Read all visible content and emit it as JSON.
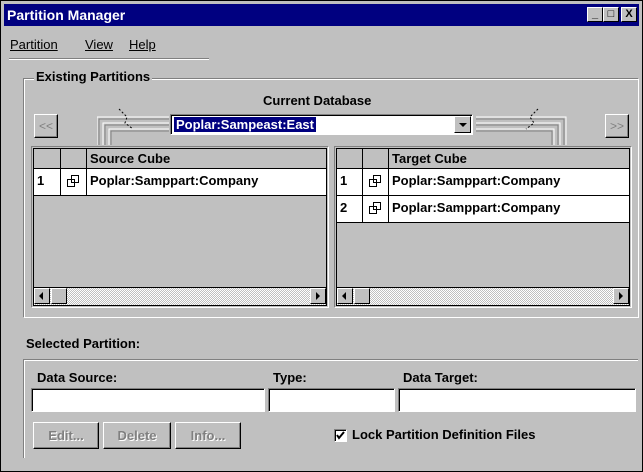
{
  "window": {
    "title": "Partition Manager"
  },
  "title_buttons": {
    "minimize": "_",
    "maximize": "□",
    "close": "X"
  },
  "menu": {
    "items": [
      {
        "label": "Partition"
      },
      {
        "label": "View"
      },
      {
        "label": "Help"
      }
    ]
  },
  "existing": {
    "group_label": "Existing Partitions",
    "current_db_label": "Current Database",
    "current_db_value": "Poplar:Sampeast:East",
    "prev_label": "<<",
    "next_label": ">>",
    "source": {
      "header": "Source Cube",
      "rows": [
        {
          "num": "1",
          "name": "Poplar:Samppart:Company"
        }
      ]
    },
    "target": {
      "header": "Target Cube",
      "rows": [
        {
          "num": "1",
          "name": "Poplar:Samppart:Company"
        },
        {
          "num": "2",
          "name": "Poplar:Samppart:Company"
        }
      ]
    }
  },
  "selected": {
    "label": "Selected Partition:",
    "data_source_label": "Data Source:",
    "type_label": "Type:",
    "data_target_label": "Data Target:",
    "data_source_value": "",
    "type_value": "",
    "data_target_value": "",
    "edit_label": "Edit...",
    "delete_label": "Delete",
    "info_label": "Info...",
    "lock_label": "Lock Partition Definition Files",
    "lock_checked": true
  }
}
